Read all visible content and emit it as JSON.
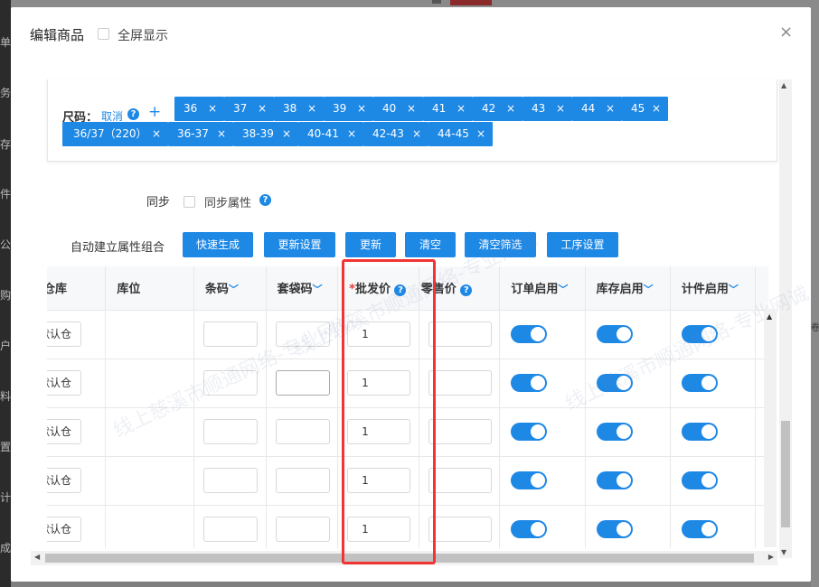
{
  "background": {
    "sidebar_glyphs": [
      "单",
      "务",
      "存",
      "件",
      "公",
      "购",
      "户",
      "料",
      "置",
      "计",
      "成"
    ],
    "right_glyph": "卷"
  },
  "modal": {
    "title": "编辑商品",
    "fullscreen_label": "全屏显示",
    "close_symbol": "×"
  },
  "size": {
    "label": "尺码：",
    "cancel": "取消",
    "help": "?",
    "add": "+",
    "tags_row1": [
      "36",
      "37",
      "38",
      "39",
      "40",
      "41",
      "42",
      "43",
      "44",
      "45"
    ],
    "tags_row2": [
      "36/37（220）",
      "36-37",
      "38-39",
      "40-41",
      "42-43",
      "44-45"
    ],
    "remove_symbol": "×"
  },
  "sync": {
    "label": "同步",
    "option": "同步属性",
    "help": "?"
  },
  "auto_build": {
    "label": "自动建立属性组合",
    "buttons": [
      "快速生成",
      "更新设置",
      "更新",
      "清空",
      "清空筛选",
      "工序设置"
    ]
  },
  "table": {
    "headers": {
      "warehouse": "仓库",
      "location": "库位",
      "barcode": "条码",
      "bag_code": "套袋码",
      "wholesale_required": "*",
      "wholesale": "批发价",
      "retail": "零售价",
      "order_enabled": "订单启用",
      "stock_enabled": "库存启用",
      "piece_enabled": "计件启用",
      "chevron": "﹀",
      "help": "?"
    },
    "rows": [
      {
        "warehouse": "默认仓",
        "wholesale": "1"
      },
      {
        "warehouse": "默认仓",
        "wholesale": "1"
      },
      {
        "warehouse": "默认仓",
        "wholesale": "1"
      },
      {
        "warehouse": "默认仓",
        "wholesale": "1"
      },
      {
        "warehouse": "默认仓",
        "wholesale": "1"
      }
    ]
  },
  "scroll": {
    "up": "▲",
    "down": "▼",
    "left": "◀",
    "right": "▶"
  },
  "watermark": {
    "text": "线上慈溪市顺通网络-专业网诚"
  },
  "colors": {
    "accent": "#1e88e5",
    "highlight": "#f23434",
    "required": "#e53935"
  }
}
